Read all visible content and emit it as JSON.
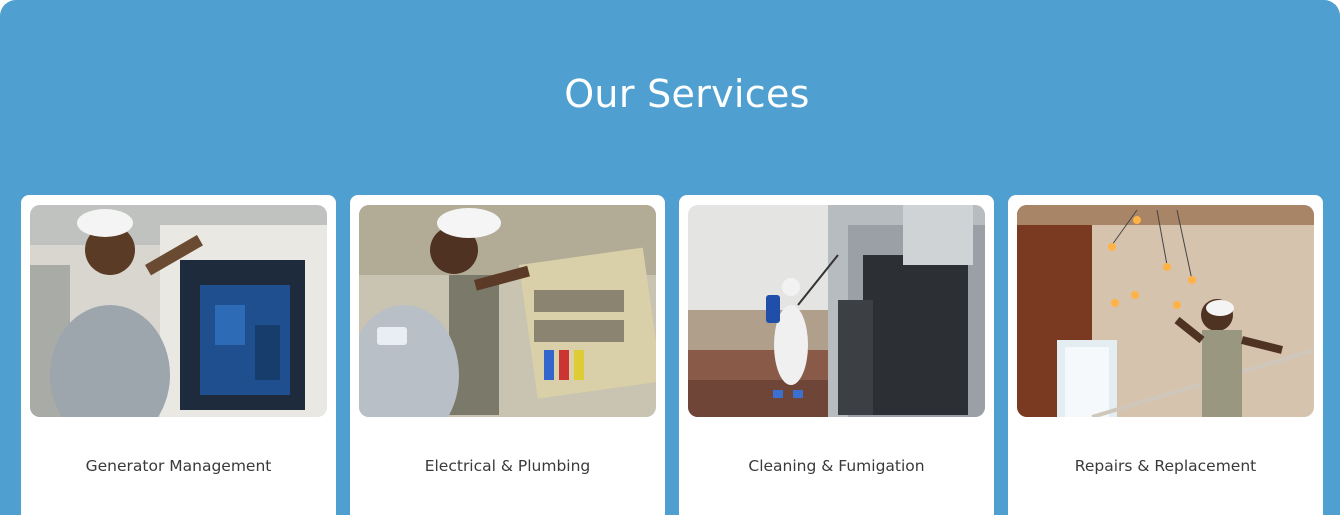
{
  "section": {
    "title": "Our Services"
  },
  "services": [
    {
      "label": "Generator Management",
      "image": "technician-servicing-generator-photo"
    },
    {
      "label": "Electrical & Plumbing",
      "image": "technician-inspecting-electrical-panel-photo"
    },
    {
      "label": "Cleaning & Fumigation",
      "image": "worker-spraying-rooftop-photo"
    },
    {
      "label": "Repairs & Replacement",
      "image": "technician-fixing-chandelier-photo"
    }
  ],
  "colors": {
    "panel_background": "#4f9fd0",
    "card_background": "#ffffff",
    "title_text": "#ffffff",
    "label_text": "#3a3a3a"
  }
}
